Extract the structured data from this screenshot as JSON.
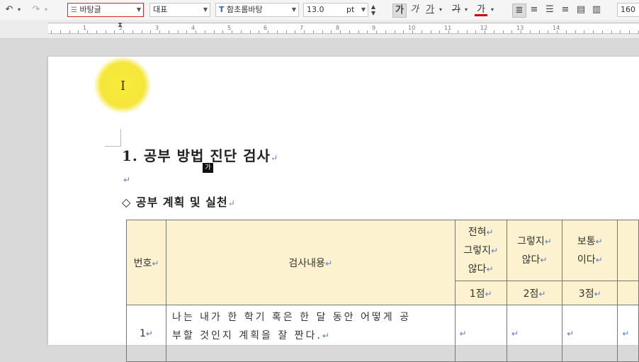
{
  "toolbar": {
    "style_value": "바탕글",
    "text_option_value": "대표",
    "font_value": "함초롬바탕",
    "font_size_value": "13.0",
    "font_size_unit": "pt",
    "bold_glyph": "가",
    "italic_glyph": "가",
    "underline_glyph": "가",
    "strike_glyph": "가",
    "color_glyph": "가",
    "line_spacing_value": "160"
  },
  "ruler": {
    "numbers": [
      "1",
      "2",
      "3",
      "4",
      "5",
      "6",
      "7",
      "8",
      "9",
      "10",
      "11",
      "12",
      "13",
      "14"
    ]
  },
  "document": {
    "heading": "1. 공부 방법 진단 검사",
    "heading_tag": "가",
    "subheading": "◇ 공부 계획 및 실천",
    "paragraph_mark": "↵"
  },
  "table": {
    "header": {
      "col_no": "번호",
      "col_content": "검사내용",
      "choices": [
        {
          "lines": [
            "전혀",
            "그렇지",
            "않다"
          ],
          "score": "1점"
        },
        {
          "lines": [
            "그렇지",
            "않다"
          ],
          "score": "2점"
        },
        {
          "lines": [
            "보통",
            "이다"
          ],
          "score": "3점"
        }
      ]
    },
    "rows": [
      {
        "no": "1",
        "content_lines": [
          "나는 내가 한 학기 혹은 한 달 동안 어떻게 공",
          "부할 것인지 계획을 잘 짠다."
        ]
      }
    ]
  }
}
